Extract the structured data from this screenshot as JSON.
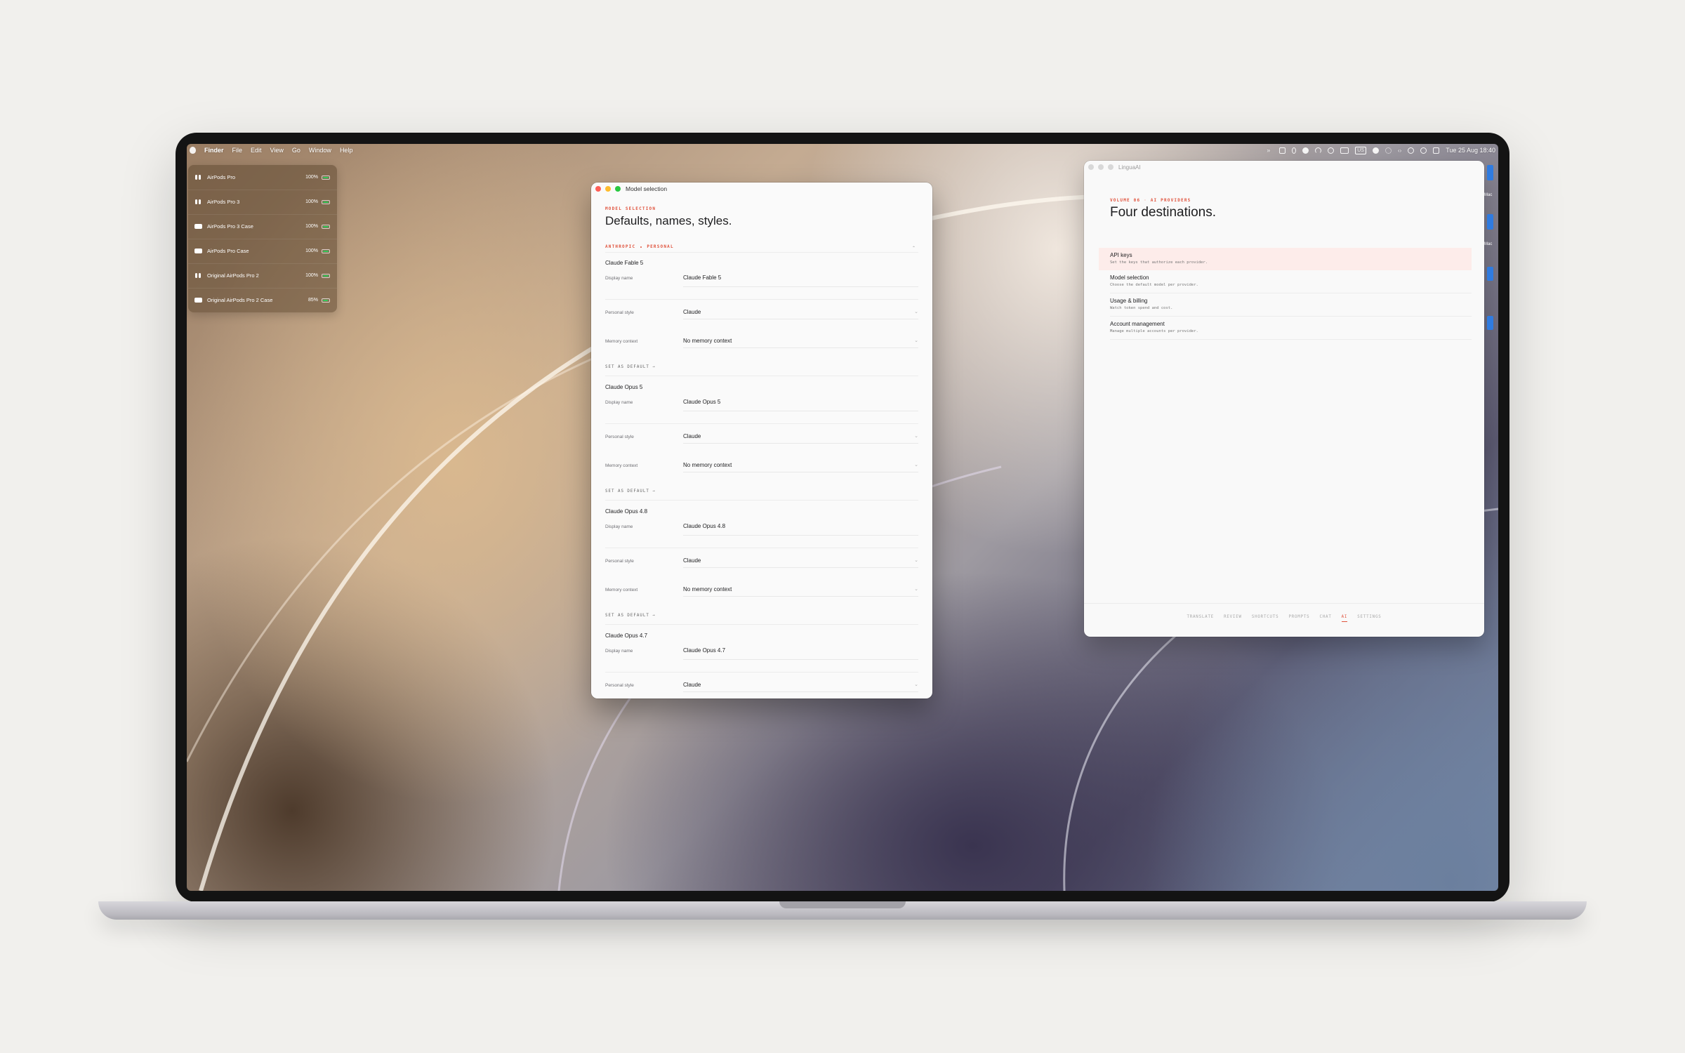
{
  "menubar": {
    "app": "Finder",
    "menus": [
      "File",
      "Edit",
      "View",
      "Go",
      "Window",
      "Help"
    ],
    "status_icons": [
      "chevron-double-right-icon",
      "keyboard-icon",
      "microphone-icon",
      "chat-bubble-icon",
      "wifi-icon",
      "record-icon",
      "screen-icon",
      "keyboard-layout-badge",
      "play-circle-icon",
      "settings-icon",
      "code-icon",
      "focus-icon",
      "minus-circle-icon",
      "control-center-icon"
    ],
    "clock": "Tue 25 Aug  18:40"
  },
  "airpods": {
    "devices": [
      {
        "name": "AirPods Pro",
        "percent": "100%",
        "level": 1.0,
        "kind": "buds"
      },
      {
        "name": "AirPods Pro 3",
        "percent": "100%",
        "level": 1.0,
        "kind": "buds"
      },
      {
        "name": "AirPods Pro 3 Case",
        "percent": "100%",
        "level": 1.0,
        "kind": "case"
      },
      {
        "name": "AirPods Pro Case",
        "percent": "100%",
        "level": 1.0,
        "kind": "case"
      },
      {
        "name": "Original AirPods Pro 2",
        "percent": "100%",
        "level": 1.0,
        "kind": "buds"
      },
      {
        "name": "Original AirPods Pro 2 Case",
        "percent": "85%",
        "level": 0.85,
        "kind": "case"
      }
    ]
  },
  "model_window": {
    "title": "Model selection",
    "eyebrow": "MODEL SELECTION",
    "heading": "Defaults, names, styles.",
    "scope": [
      "ANTHROPIC",
      "PERSONAL"
    ],
    "labels": {
      "display_name": "Display name",
      "personal_style": "Personal style",
      "memory_context": "Memory context",
      "set_default": "SET AS DEFAULT  →"
    },
    "models": [
      {
        "name": "Claude Fable 5",
        "display_name": "Claude Fable 5",
        "style": "Claude",
        "memory": "No memory context"
      },
      {
        "name": "Claude Opus 5",
        "display_name": "Claude Opus 5",
        "style": "Claude",
        "memory": "No memory context"
      },
      {
        "name": "Claude Opus 4.8",
        "display_name": "Claude Opus 4.8",
        "style": "Claude",
        "memory": "No memory context"
      },
      {
        "name": "Claude Opus 4.7",
        "display_name": "Claude Opus 4.7",
        "style": "Claude"
      }
    ]
  },
  "lingua_window": {
    "title": "LinguaAI",
    "eyebrow_prefix": "VOLUME 06",
    "eyebrow_sep": " · ",
    "eyebrow": "AI PROVIDERS",
    "heading": "Four destinations.",
    "destinations": [
      {
        "title": "API keys",
        "desc": "Set the keys that authorize each provider."
      },
      {
        "title": "Model selection",
        "desc": "Choose the default model per provider."
      },
      {
        "title": "Usage & billing",
        "desc": "Watch token spend and cost."
      },
      {
        "title": "Account management",
        "desc": "Manage multiple accounts per provider."
      }
    ],
    "tabs": [
      "TRANSLATE",
      "REVIEW",
      "SHORTCUTS",
      "PROMPTS",
      "CHAT",
      "AI",
      "SETTINGS"
    ],
    "active_tab": "AI"
  },
  "desktop_peek": [
    "Mac",
    "Mac"
  ],
  "colors": {
    "accent": "#e0533d",
    "active_row": "#fdecea",
    "battery_green": "#35c759"
  }
}
